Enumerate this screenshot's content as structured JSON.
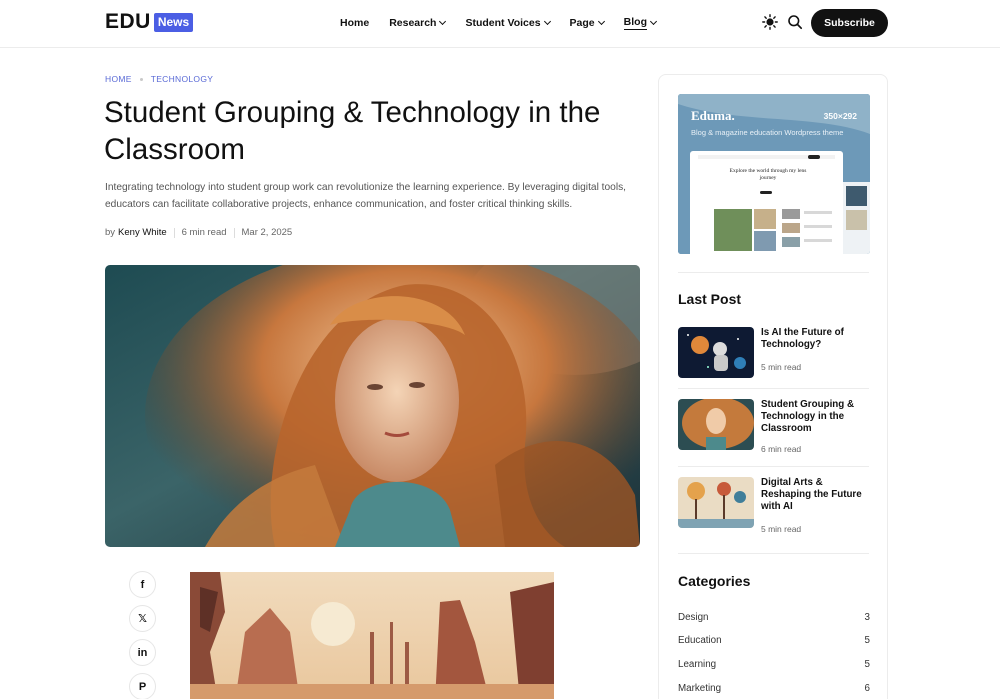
{
  "header": {
    "logo_main": "EDU",
    "logo_badge": "News",
    "nav": [
      {
        "label": "Home",
        "dropdown": false
      },
      {
        "label": "Research",
        "dropdown": true
      },
      {
        "label": "Student Voices",
        "dropdown": true
      },
      {
        "label": "Page",
        "dropdown": true
      },
      {
        "label": "Blog",
        "dropdown": true,
        "active": true
      }
    ],
    "icons": [
      "sun-icon",
      "search-icon"
    ],
    "subscribe_label": "Subscribe"
  },
  "article": {
    "breadcrumb": [
      "HOME",
      "TECHNOLOGY"
    ],
    "title": "Student Grouping & Technology in the Classroom",
    "excerpt": "Integrating technology into student group work can revolutionize the learning experience. By leveraging digital tools, educators can facilitate collaborative projects, enhance communication, and foster critical thinking skills.",
    "by": "by",
    "author": "Keny White",
    "read_time": "6 min read",
    "date": "Mar 2, 2025",
    "share_icons": [
      "facebook-icon",
      "x-icon",
      "linkedin-icon",
      "pinterest-icon"
    ],
    "share_glyphs": [
      "f",
      "𝕏",
      "in",
      "P"
    ]
  },
  "sidebar": {
    "ad": {
      "brand": "Eduma.",
      "size": "350×292",
      "subtitle": "Blog & magazine education Wordpress theme",
      "shot_text": "Explore the world through my lens journey"
    },
    "last_post_title": "Last Post",
    "last_posts": [
      {
        "title": "Is AI the Future of Technology?",
        "read": "5 min read"
      },
      {
        "title": "Student Grouping & Technology in the Classroom",
        "read": "6 min read"
      },
      {
        "title": "Digital Arts & Reshaping the Future with AI",
        "read": "5 min read"
      }
    ],
    "categories_title": "Categories",
    "categories": [
      {
        "name": "Design",
        "count": "3"
      },
      {
        "name": "Education",
        "count": "5"
      },
      {
        "name": "Learning",
        "count": "5"
      },
      {
        "name": "Marketing",
        "count": "6"
      }
    ]
  },
  "colors": {
    "accent": "#4b5ee4",
    "breadcrumb": "#5a6ad6",
    "text": "#111111",
    "muted": "#666666"
  }
}
